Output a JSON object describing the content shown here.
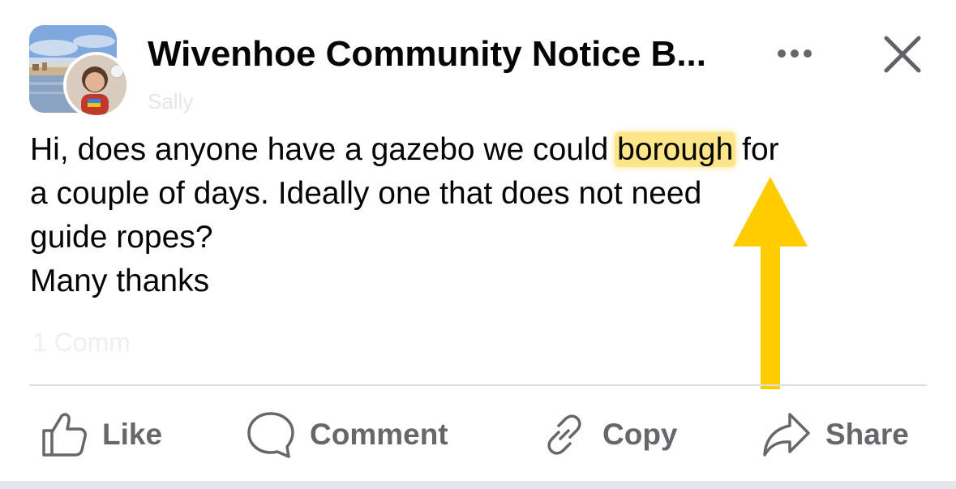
{
  "header": {
    "group_name": "Wivenhoe Community Notice B...",
    "author_faded": "Sally"
  },
  "post": {
    "lines": [
      {
        "before": "Hi, does anyone have a gazebo we could ",
        "highlight": "borough",
        "after": " for"
      },
      {
        "text": "a couple of days. Ideally one that does not need"
      },
      {
        "text": "guide ropes?"
      },
      {
        "text": "Many thanks"
      }
    ],
    "faded_footer": "1 Comm"
  },
  "actions": {
    "like": "Like",
    "comment": "Comment",
    "copy": "Copy",
    "share": "Share"
  },
  "colors": {
    "highlight": "#fde68a",
    "arrow": "#ffcc00",
    "action_text": "#65676b",
    "text": "#050505"
  },
  "icons": {
    "more": "more-dots-icon",
    "close": "close-icon",
    "like": "thumbs-up-icon",
    "comment": "speech-bubble-icon",
    "copy": "link-icon",
    "share": "share-arrow-icon"
  }
}
